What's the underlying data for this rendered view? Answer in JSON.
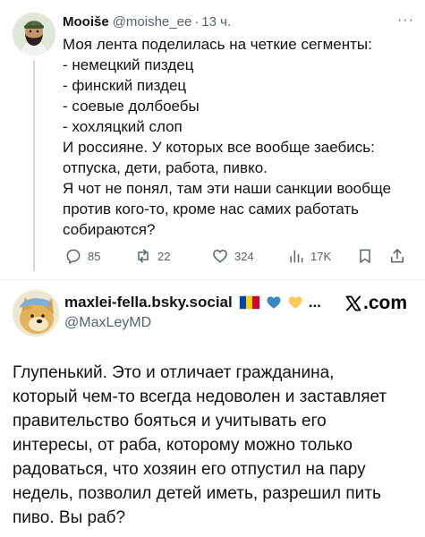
{
  "tweet": {
    "author_name": "Mooiše",
    "handle": "@moishe_ee",
    "separator": "·",
    "time": "13 ч.",
    "more": "···",
    "lines": [
      "Моя лента поделилась на четкие сегменты:",
      "- немецкий пиздец",
      "- финский пиздец",
      "- соевые долбоебы",
      "- хохляцкий слоп",
      "И россияне. У которых все вообще заебись:",
      "отпуска, дети, работа, пивко.",
      "Я чот не понял, там эти наши санкции вообще",
      "против кого-то, кроме нас самих работать",
      "собираются?"
    ],
    "actions": {
      "replies": "85",
      "reposts": "22",
      "likes": "324",
      "views": "17K"
    }
  },
  "reply": {
    "author_name": "maxlei-fella.bsky.social",
    "ellipsis": "...",
    "handle": "@MaxLeyMD",
    "brand": ".com",
    "lines": [
      "Глупенький. Это и отличает гражданина,",
      "который чем-то всегда недоволен и заставляет",
      "правительство бояться и учитывать его",
      "интересы, от раба, которому можно только",
      "радоваться, что хозяин его отпустил на пару",
      "недель, позволил детей иметь, разрешил пить",
      "пиво. Вы раб?"
    ]
  },
  "icons": {
    "reply": "reply-icon",
    "repost": "repost-icon",
    "like": "like-icon",
    "views": "views-icon",
    "bookmark": "bookmark-icon",
    "share": "share-icon",
    "x_logo": "x-logo-icon"
  },
  "colors": {
    "text": "#0f1419",
    "muted": "#536471",
    "flag_blue": "#0046ae",
    "flag_yellow": "#ffd200",
    "flag_red": "#cc092f",
    "heart_blue": "#3b88c3",
    "heart_yellow": "#fdcb58"
  }
}
